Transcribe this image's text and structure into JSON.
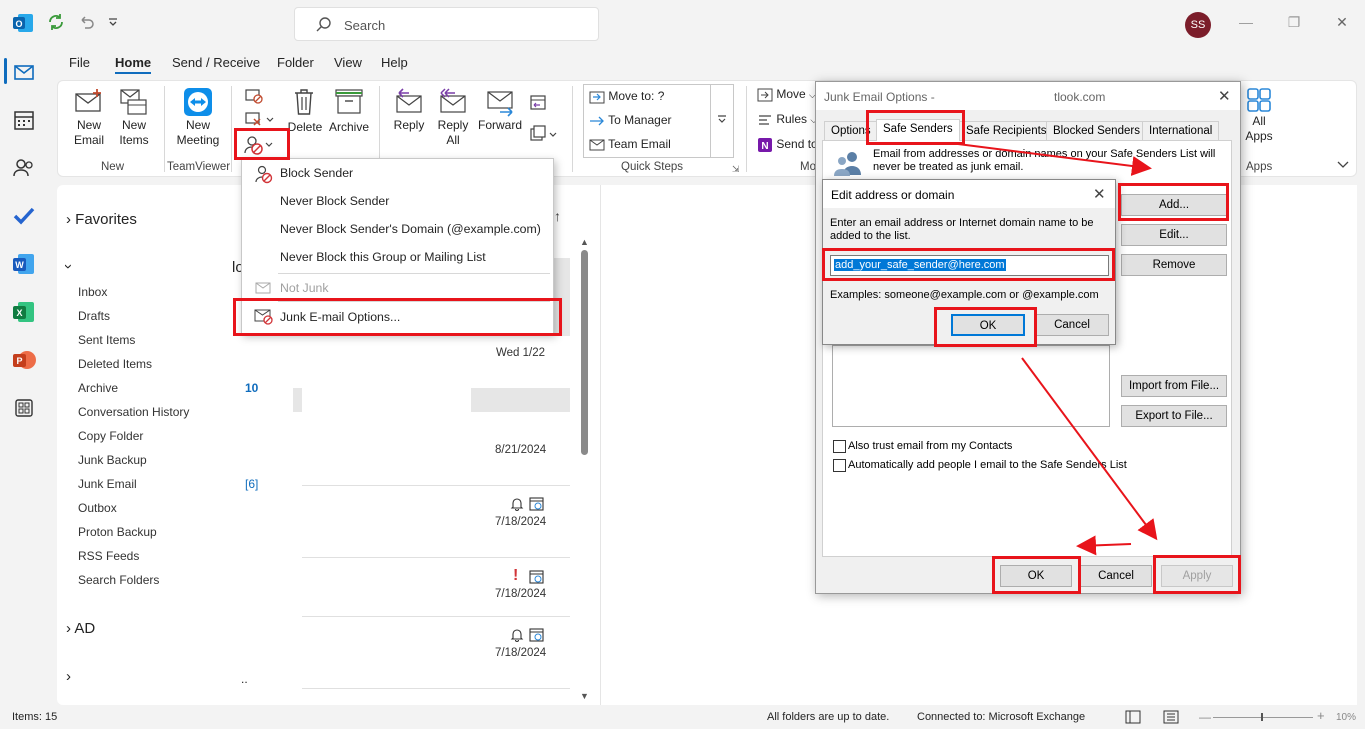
{
  "search": {
    "placeholder": "Search"
  },
  "user": {
    "initials": "SS"
  },
  "menu": {
    "tabs": [
      "File",
      "Home",
      "Send / Receive",
      "Folder",
      "View",
      "Help"
    ]
  },
  "ribbon": {
    "new_email": [
      "New",
      "Email"
    ],
    "new_items": [
      "New",
      "Items"
    ],
    "group_new": "New",
    "new_meeting": [
      "New",
      "Meeting"
    ],
    "group_teamviewer": "TeamViewer",
    "delete": "Delete",
    "archive": "Archive",
    "reply": "Reply",
    "reply_all": [
      "Reply",
      "All"
    ],
    "forward": "Forward",
    "quick_steps": [
      "Move to: ?",
      "To Manager",
      "Team Email"
    ],
    "group_quick_steps": "Quick Steps",
    "move": "Move",
    "rules": "Rules",
    "send_to": "Send to",
    "group_mo": "Mo",
    "all_apps": [
      "All",
      "Apps"
    ],
    "group_apps": "Apps"
  },
  "junk_menu": {
    "items": [
      "Block Sender",
      "Never Block Sender",
      "Never Block Sender's Domain (@example.com)",
      "Never Block this Group or Mailing List",
      "Not Junk",
      "Junk E-mail Options..."
    ]
  },
  "folders": {
    "favorites": "Favorites",
    "account_label": "lo",
    "items": [
      {
        "name": "Inbox",
        "count": ""
      },
      {
        "name": "Drafts",
        "count": ""
      },
      {
        "name": "Sent Items",
        "count": ""
      },
      {
        "name": "Deleted Items",
        "count": ""
      },
      {
        "name": "Archive",
        "count": "10"
      },
      {
        "name": "Conversation History",
        "count": ""
      },
      {
        "name": "Copy Folder",
        "count": ""
      },
      {
        "name": "Junk Backup",
        "count": ""
      },
      {
        "name": "Junk Email",
        "count": "[6]"
      },
      {
        "name": "Outbox",
        "count": ""
      },
      {
        "name": "Proton Backup",
        "count": ""
      },
      {
        "name": "RSS Feeds",
        "count": ""
      },
      {
        "name": "Search Folders",
        "count": ""
      }
    ],
    "group_ad": "AD",
    "more": ".."
  },
  "messages": {
    "dates": [
      "Wed 1/22",
      "8/21/2024",
      "7/18/2024",
      "7/18/2024",
      "7/18/2024"
    ]
  },
  "junk_dialog": {
    "title": "Junk Email Options -",
    "title_suffix": "tlook.com",
    "tabs": [
      "Options",
      "Safe Senders",
      "Safe Recipients",
      "Blocked Senders",
      "International"
    ],
    "info": "Email from addresses or domain names on your Safe Senders List will never be treated as junk email.",
    "buttons": {
      "add": "Add...",
      "edit": "Edit...",
      "remove": "Remove",
      "import": "Import from File...",
      "export": "Export to File..."
    },
    "checkboxes": [
      "Also trust email from my Contacts",
      "Automatically add people I email to the Safe Senders List"
    ],
    "ok": "OK",
    "cancel": "Cancel",
    "apply": "Apply"
  },
  "edit_dialog": {
    "title": "Edit address or domain",
    "prompt": "Enter an email address or Internet domain name to be added to the list.",
    "value": "add_your_safe_sender@here.com",
    "examples": "Examples: someone@example.com or @example.com",
    "ok": "OK",
    "cancel": "Cancel"
  },
  "status": {
    "items": "Items: 15",
    "sync": "All folders are up to date.",
    "connection": "Connected to: Microsoft Exchange",
    "zoom": "10%"
  },
  "colors": {
    "accent": "#0f6cbd",
    "annotation": "#e8141b",
    "avatar": "#7b1d2a"
  }
}
